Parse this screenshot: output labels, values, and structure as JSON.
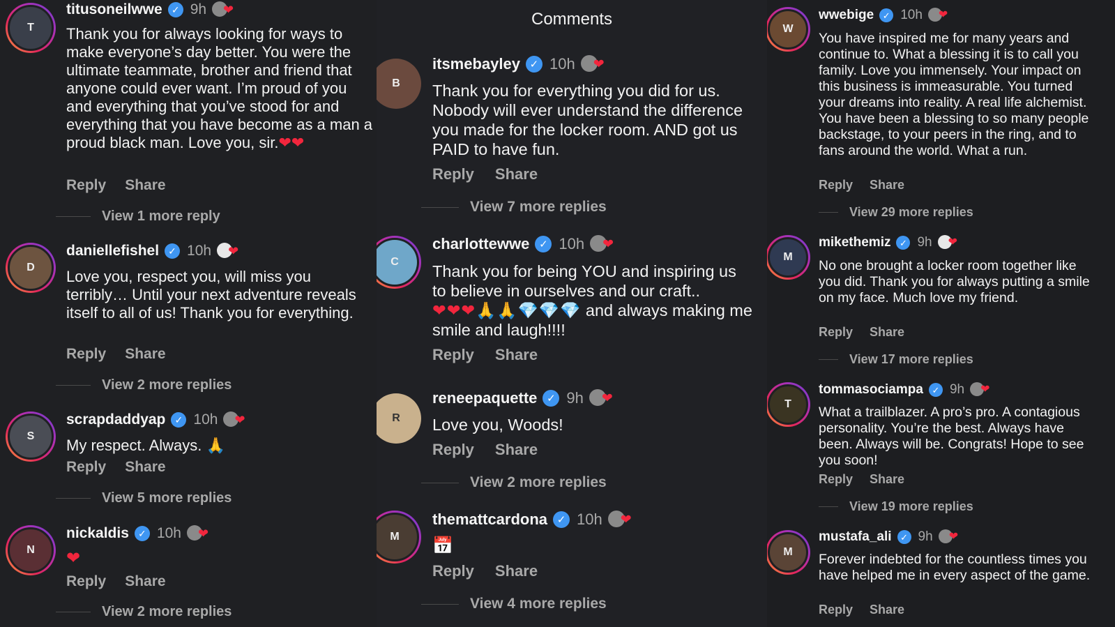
{
  "header": {
    "title": "Comments"
  },
  "icons": {
    "verified": "verified-badge-icon",
    "liked_by_creator": "creator-heart-icon",
    "heart_emoji": "heart-emoji",
    "pray_emoji": "pray-emoji",
    "diamond_emoji": "diamond-emoji",
    "calendar_emoji": "calendar-emoji"
  },
  "colors": {
    "background": "#202124",
    "verified": "#3f96f2",
    "heart": "#f2263d",
    "muted": "#a9a9a9"
  },
  "actions": {
    "reply": "Reply",
    "share": "Share"
  },
  "columns": [
    {
      "comments": [
        {
          "user": "titusoneilwwe",
          "time": "9h",
          "text": "Thank you for always looking for ways to make everyone’s day better. You were the ultimate teammate, brother and friend that anyone could ever want. I’m proud of you and everything that you’ve stood for and everything that you have become as a man a proud black man. Love you, sir.",
          "emoji": "❤❤",
          "more": "View 1 more reply"
        },
        {
          "user": "daniellefishel",
          "time": "10h",
          "text": "Love you, respect you, will miss you terribly… Until your next adventure reveals itself to all of us! Thank you for everything.",
          "emoji": "",
          "more": "View 2 more replies"
        },
        {
          "user": "scrapdaddyap",
          "time": "10h",
          "text": "My respect. Always. ",
          "emoji": "🙏",
          "more": "View 5 more replies"
        },
        {
          "user": "nickaldis",
          "time": "10h",
          "text": "",
          "emoji": "❤",
          "more": "View 2 more replies"
        }
      ]
    },
    {
      "comments": [
        {
          "user": "itsmebayley",
          "time": "10h",
          "text": "Thank you for everything you did for us. Nobody will ever understand the difference you made for the locker room. AND got us PAID to have fun.",
          "emoji": "",
          "more": "View 7 more replies"
        },
        {
          "user": "charlottewwe",
          "time": "10h",
          "text": "Thank you for being YOU and inspiring us to believe in ourselves and our craft..",
          "emoji": "❤❤❤🙏🙏💎💎💎",
          "text2": " and always making me smile and laugh!!!!",
          "more": ""
        },
        {
          "user": "reneepaquette",
          "time": "9h",
          "text": "Love you, Woods!",
          "emoji": "",
          "more": "View 2 more replies"
        },
        {
          "user": "themattcardona",
          "time": "10h",
          "text": "",
          "emoji": "📅",
          "more": "View 4 more replies"
        }
      ]
    },
    {
      "comments": [
        {
          "user": "wwebige",
          "time": "10h",
          "text": "You have inspired me for many years and continue to. What a blessing it is to call you family. Love you immensely. Your impact on this business is immeasurable. You turned your dreams into reality. A real life alchemist. You have been a blessing to so many people backstage, to your peers in the ring, and to fans around the world. What a run.",
          "emoji": "",
          "more": "View 29 more replies"
        },
        {
          "user": "mikethemiz",
          "time": "9h",
          "text": "No one brought a locker room together like you did. Thank you for always putting a smile on my face. Much love my friend.",
          "emoji": "",
          "more": "View 17 more replies"
        },
        {
          "user": "tommasociampa",
          "time": "9h",
          "text": "What a trailblazer. A pro’s pro. A contagious personality. You’re the best. Always have been. Always will be. Congrats! Hope to see you soon!",
          "emoji": "",
          "more": "View 19 more replies"
        },
        {
          "user": "mustafa_ali",
          "time": "9h",
          "text": "Forever indebted for the countless times you have helped me in every aspect of the game.",
          "emoji": "",
          "more": ""
        }
      ]
    }
  ]
}
